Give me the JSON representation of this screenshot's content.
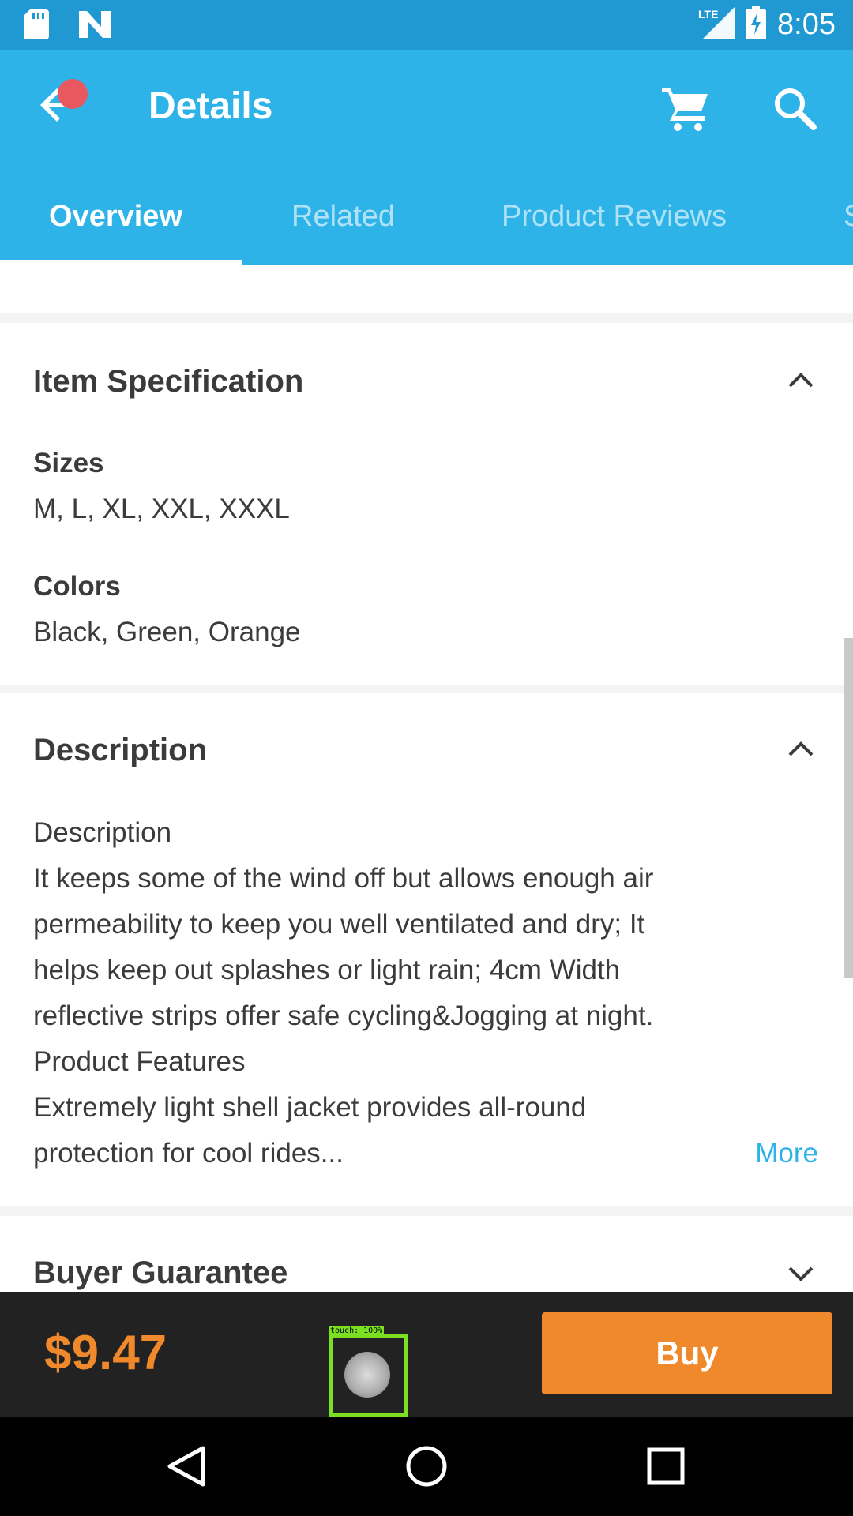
{
  "status_bar": {
    "time": "8:05",
    "network": "LTE"
  },
  "app_bar": {
    "title": "Details"
  },
  "tabs": [
    {
      "label": "Overview"
    },
    {
      "label": "Related"
    },
    {
      "label": "Product Reviews"
    },
    {
      "label": "S"
    }
  ],
  "item_spec": {
    "title": "Item Specification",
    "sizes_label": "Sizes",
    "sizes_value": "M, L, XL, XXL, XXXL",
    "colors_label": "Colors",
    "colors_value": "Black, Green, Orange"
  },
  "description": {
    "title": "Description",
    "lines": [
      "Description",
      "It keeps some of the wind off but allows enough air",
      "permeability to keep you well ventilated and dry; It",
      "helps keep out splashes or light rain; 4cm Width",
      "reflective strips offer safe cycling&Jogging at night.",
      "Product Features",
      "Extremely light shell jacket provides all-round",
      "protection for cool rides..."
    ],
    "more": "More"
  },
  "buyer_guarantee": {
    "title": "Buyer Guarantee"
  },
  "bottom_bar": {
    "price": "$9.47",
    "buy_label": "Buy",
    "touch_label": "touch: 100%"
  },
  "colors": {
    "primary": "#2db3e8",
    "status_bar": "#2098d1",
    "accent": "#f0892c",
    "badge": "#e8585e"
  },
  "icons": {
    "status_left": [
      "sd-card-icon",
      "n-icon"
    ],
    "status_right": [
      "lte-signal-icon",
      "battery-charging-icon"
    ],
    "app_bar": [
      "back-arrow-icon",
      "cart-icon",
      "search-icon"
    ],
    "nav": [
      "back-triangle-icon",
      "home-circle-icon",
      "recents-square-icon"
    ]
  }
}
